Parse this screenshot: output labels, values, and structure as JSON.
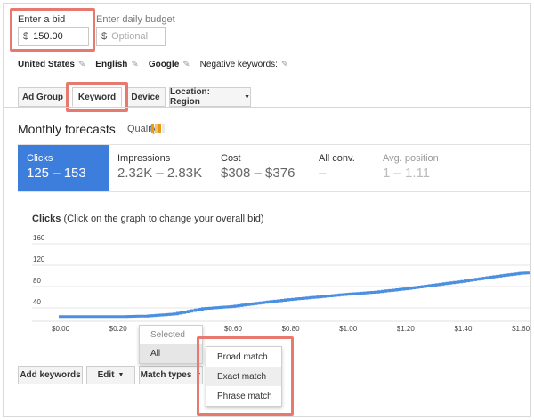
{
  "bid": {
    "bid_label": "Enter a bid",
    "currency": "$",
    "bid_value": "150.00",
    "budget_label": "Enter daily budget",
    "budget_placeholder": "Optional"
  },
  "settings": {
    "country": "United States",
    "language": "English",
    "network": "Google",
    "negative_keywords": "Negative keywords:"
  },
  "tabs": [
    {
      "label": "Ad Group"
    },
    {
      "label": "Keyword"
    },
    {
      "label": "Device"
    },
    {
      "label": "Location: Region"
    }
  ],
  "forecasts": {
    "title": "Monthly forecasts",
    "quality_label": "Quality:"
  },
  "metrics": [
    {
      "label": "Clicks",
      "value": "125 – 153"
    },
    {
      "label": "Impressions",
      "value": "2.32K – 2.83K"
    },
    {
      "label": "Cost",
      "value": "$308 – $376"
    },
    {
      "label": "All conv.",
      "value": "–"
    },
    {
      "label": "Avg. position",
      "value": "1 – 1.11"
    }
  ],
  "chart_caption": {
    "bold": "Clicks",
    "rest": " (Click on the graph to change your overall bid)"
  },
  "chart_data": {
    "type": "line",
    "title": "Clicks",
    "xlabel": "",
    "ylabel": "",
    "ylim": [
      0,
      160
    ],
    "xlim": [
      0,
      1.64
    ],
    "y_ticks": [
      "160",
      "120",
      "80",
      "40"
    ],
    "x_ticks": [
      "$0.00",
      "$0.20",
      "$0.40",
      "$0.60",
      "$0.80",
      "$1.00",
      "$1.20",
      "$1.40",
      "$1.60"
    ],
    "grid": true,
    "series": [
      {
        "x": [
          0.0,
          0.1,
          0.2,
          0.3,
          0.4,
          0.5,
          0.6,
          0.7,
          0.8,
          0.9,
          1.0,
          1.1,
          1.2,
          1.3,
          1.4,
          1.5,
          1.6,
          1.64
        ],
        "y": [
          7,
          7,
          7,
          8,
          12,
          22,
          26,
          33,
          39,
          44,
          49,
          53,
          59,
          66,
          73,
          81,
          88,
          89
        ]
      }
    ],
    "color": "#4a8fe0"
  },
  "buttons": {
    "add_keywords": "Add keywords",
    "edit": "Edit",
    "match_types": "Match types"
  },
  "selected_menu": {
    "header": "Selected",
    "item": "All"
  },
  "match_menu": {
    "items": [
      "Broad match",
      "Exact match",
      "Phrase match"
    ]
  },
  "colors": {
    "highlight": "#e8796e",
    "accent_blue": "#3d7ddc",
    "line_blue": "#4a8fe0"
  }
}
